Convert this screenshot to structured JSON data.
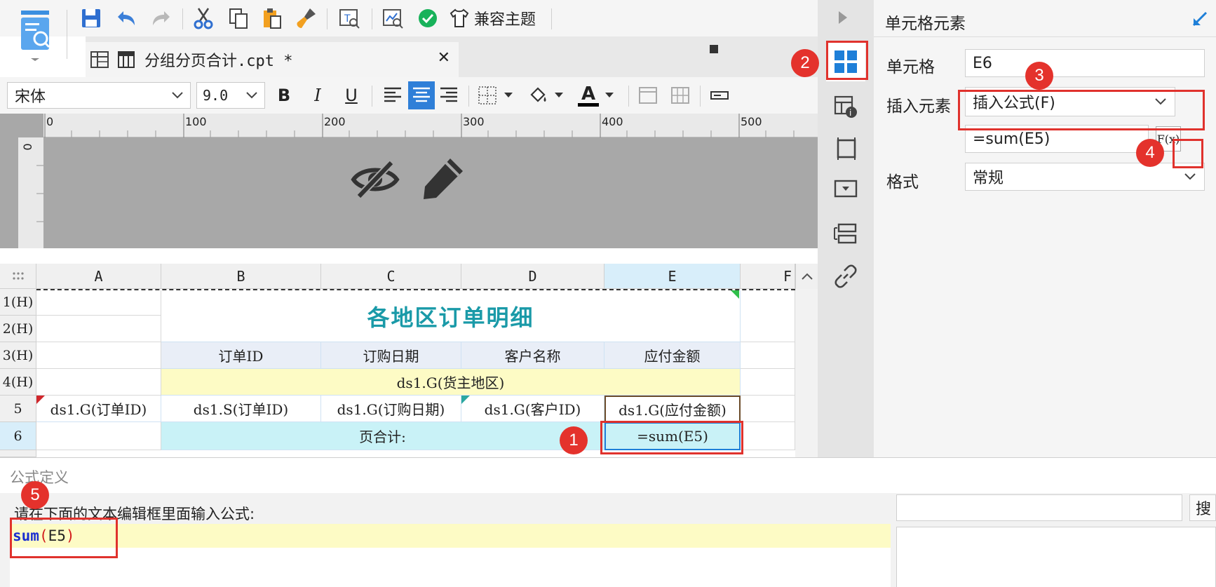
{
  "toolbar": {
    "theme_label": "兼容主题"
  },
  "tab": {
    "filename": "分组分页合计.cpt *",
    "close": "✕"
  },
  "font_toolbar": {
    "font_name": "宋体",
    "font_size": "9.0",
    "bold": "B",
    "italic": "I",
    "underline": "U",
    "font_color_letter": "A"
  },
  "ruler": {
    "ticks": [
      "0",
      "100",
      "200",
      "300",
      "400",
      "500"
    ],
    "vertical_zero": "0"
  },
  "sheet": {
    "columns": [
      "A",
      "B",
      "C",
      "D",
      "E",
      "F"
    ],
    "rows": [
      "1(H)",
      "2(H)",
      "3(H)",
      "4(H)",
      "5",
      "6"
    ],
    "title": "各地区订单明细",
    "headers": [
      "订单ID",
      "订购日期",
      "客户名称",
      "应付金额"
    ],
    "group_cell": "ds1.G(货主地区)",
    "row5": [
      "ds1.G(订单ID)",
      "ds1.S(订单ID)",
      "ds1.G(订购日期)",
      "ds1.G(客户ID)",
      "ds1.G(应付金额)"
    ],
    "row6_label": "页合计:",
    "row6_formula": "=sum(E5)"
  },
  "props": {
    "panel_title": "单元格元素",
    "cell_label": "单元格",
    "cell_value": "E6",
    "insert_label": "插入元素",
    "insert_value": "插入公式(F)",
    "formula_value": "=sum(E5)",
    "format_label": "格式",
    "format_value": "常规",
    "fx_label": "F(x)"
  },
  "dialog": {
    "title": "公式定义",
    "prompt": "请在下面的文本编辑框里面输入公式:",
    "formula_func": "sum",
    "formula_args": "E5",
    "search_btn": "搜"
  },
  "badges": [
    "1",
    "2",
    "3",
    "4",
    "5"
  ],
  "colors": {
    "accent_blue": "#1e7fd8",
    "title_teal": "#1a9aa8",
    "red": "#e4322c",
    "header_fill": "#e9eef7",
    "group_fill": "#fdfbc5",
    "total_fill": "#c9f2f7"
  }
}
